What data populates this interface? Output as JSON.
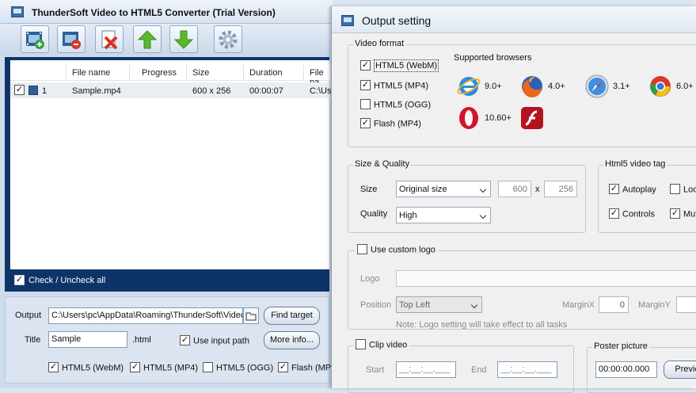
{
  "main_window": {
    "title": "ThunderSoft Video to HTML5 Converter (Trial Version)",
    "toolbar": [
      {
        "icon": "add-video-icon"
      },
      {
        "icon": "remove-video-icon"
      },
      {
        "icon": "clear-list-icon"
      },
      {
        "icon": "move-up-icon"
      },
      {
        "icon": "move-down-icon"
      },
      {
        "icon": "settings-gear-icon"
      }
    ],
    "file_list": {
      "columns": [
        "File name",
        "Progress",
        "Size",
        "Duration",
        "File pa"
      ],
      "rows": [
        {
          "checked": true,
          "index": "1",
          "file_name": "Sample.mp4",
          "progress": "",
          "size": "600 x 256",
          "duration": "00:00:07",
          "file_path": "C:\\Use"
        }
      ],
      "check_all_label": "Check / Uncheck all",
      "check_all": true
    },
    "output": {
      "output_label": "Output",
      "output_path": "C:\\Users\\pc\\AppData\\Roaming\\ThunderSoft\\Video",
      "find_target_label": "Find target",
      "title_label": "Title",
      "title_value": "Sample",
      "title_ext": ".html",
      "use_input_path_label": "Use input path",
      "use_input_path": true,
      "more_info_label": "More info...",
      "formats": [
        {
          "label": "HTML5 (WebM)",
          "checked": true
        },
        {
          "label": "HTML5 (MP4)",
          "checked": true
        },
        {
          "label": "HTML5 (OGG)",
          "checked": false
        },
        {
          "label": "Flash (MP",
          "checked": true
        }
      ]
    }
  },
  "dialog": {
    "title": "Output setting",
    "video_format": {
      "caption": "Video format",
      "options": [
        {
          "label": "HTML5 (WebM)",
          "checked": true
        },
        {
          "label": "HTML5 (MP4)",
          "checked": true
        },
        {
          "label": "HTML5 (OGG)",
          "checked": false
        },
        {
          "label": "Flash (MP4)",
          "checked": true
        }
      ],
      "browsers_caption": "Supported browsers",
      "browsers": [
        {
          "icon": "internet-explorer-icon",
          "version": "9.0+"
        },
        {
          "icon": "firefox-icon",
          "version": "4.0+"
        },
        {
          "icon": "safari-icon",
          "version": "3.1+"
        },
        {
          "icon": "chrome-icon",
          "version": "6.0+"
        },
        {
          "icon": "opera-icon",
          "version": "10.60+"
        },
        {
          "icon": "flash-icon",
          "version": ""
        }
      ]
    },
    "size_quality": {
      "caption": "Size & Quality",
      "size_label": "Size",
      "size_value": "Original size",
      "width": "600",
      "times": "x",
      "height": "256",
      "quality_label": "Quality",
      "quality_value": "High"
    },
    "video_tag": {
      "caption": "Html5 video tag",
      "autoplay_label": "Autoplay",
      "autoplay": true,
      "loop_label": "Loo",
      "loop": false,
      "controls_label": "Controls",
      "controls": true,
      "muted_label": "Mut",
      "muted": true
    },
    "logo": {
      "use_custom_logo_label": "Use custom logo",
      "use_custom_logo": false,
      "logo_label": "Logo",
      "position_label": "Position",
      "position_value": "Top Left",
      "margin_x_label": "MarginX",
      "margin_x_value": "0",
      "margin_y_label": "MarginY",
      "note": "Note: Logo setting will take effect to all tasks"
    },
    "clip": {
      "clip_video_label": "Clip video",
      "clip_video": false,
      "start_label": "Start",
      "start_value": "__:__:__.___",
      "end_label": "End",
      "end_value": "__:__:__.___"
    },
    "poster": {
      "caption": "Poster picture",
      "time_value": "00:00:00.000",
      "preview_label": "Previe"
    }
  }
}
